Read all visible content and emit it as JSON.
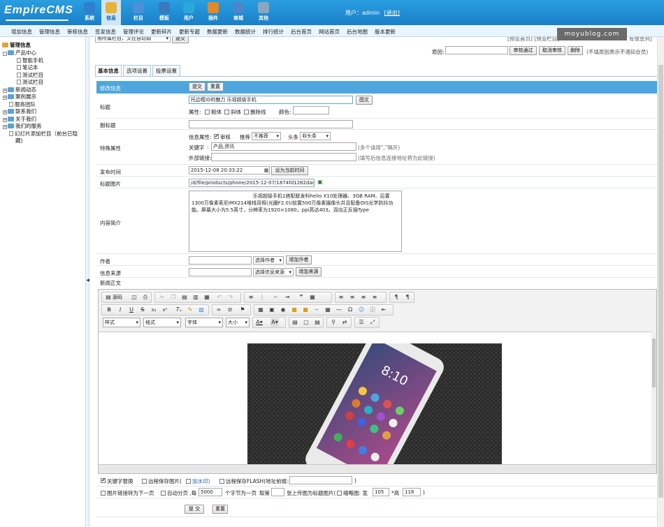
{
  "header": {
    "logo": "EmpireCMS",
    "nav": [
      {
        "label": "系统",
        "icon": "globe-icon",
        "color": "#2f7fd0"
      },
      {
        "label": "信息",
        "icon": "pencil-icon",
        "color": "#e7b33a"
      },
      {
        "label": "栏目",
        "icon": "folder-icon",
        "color": "#4b90d8"
      },
      {
        "label": "模板",
        "icon": "template-icon",
        "color": "#3a78c0"
      },
      {
        "label": "用户",
        "icon": "user-icon",
        "color": "#2aa9d8"
      },
      {
        "label": "插件",
        "icon": "puzzle-icon",
        "color": "#e28a2a"
      },
      {
        "label": "商城",
        "icon": "shop-icon",
        "color": "#4a86c8"
      },
      {
        "label": "其他",
        "icon": "gear-icon",
        "color": "#8aa6c0"
      }
    ],
    "user_prefix": "用户：",
    "username": "admin",
    "logout": "[退出]"
  },
  "menu": [
    "增加信息",
    "管理信息",
    "审核信息",
    "签发信息",
    "管理评论",
    "更新碎片",
    "更新专题",
    "数据更新",
    "数据统计",
    "排行统计",
    "后台首页",
    "网站首页",
    "后台地图",
    "版本更新"
  ],
  "sidebar": {
    "title": "管理信息",
    "tree": [
      {
        "label": "产品中心",
        "type": "folder",
        "level": 0,
        "prefix": "-"
      },
      {
        "label": "智能手机",
        "type": "page",
        "level": 2
      },
      {
        "label": "笔记本",
        "type": "page",
        "level": 2
      },
      {
        "label": "测试栏目",
        "type": "page",
        "level": 2
      },
      {
        "label": "测试栏目",
        "type": "page",
        "level": 2
      },
      {
        "label": "新闻动态",
        "type": "folder",
        "level": 0,
        "prefix": "+"
      },
      {
        "label": "案例展示",
        "type": "folder",
        "level": 0,
        "prefix": "+"
      },
      {
        "label": "服务团队",
        "type": "page",
        "level": 1
      },
      {
        "label": "联系我们",
        "type": "folder",
        "level": 0,
        "prefix": "+"
      },
      {
        "label": "关于我们",
        "type": "folder",
        "level": 0,
        "prefix": "+"
      },
      {
        "label": "我们的服务",
        "type": "folder",
        "level": 0,
        "prefix": "+"
      },
      {
        "label": "幻灯片添加栏目（前台已隐",
        "type": "page",
        "level": 1
      },
      {
        "label": "藏)",
        "type": "text",
        "level": 1
      }
    ]
  },
  "watermark": "moyublog.com",
  "top_area": {
    "partial_select": "用所属栏目，又在自动调",
    "partial_button": "提交",
    "partial_links": "[预览首页] [预览栏目]",
    "partial_right": "有信息列]",
    "reason_label": "原因:",
    "buttons": [
      "审核通过",
      "取消审核",
      "删除"
    ],
    "note": "(不填原因表示不通知会员)"
  },
  "tabs": [
    "基本信息",
    "选项设置",
    "投票设置"
  ],
  "form": {
    "section_label": "修改信息",
    "submit": "提交",
    "reset": "重置",
    "title_label": "标题",
    "title_value": "托边框ID的魅力 乐视超级手机",
    "title_image_btn": "图文",
    "attr_label": "属性:",
    "attrs": [
      "粗体",
      "斜体",
      "删除线"
    ],
    "color_label": "颜色:",
    "subtitle_label": "副标题",
    "special_label": "特殊属性",
    "info_attr_label": "信息属性:",
    "review_label": "审核",
    "recommend_label": "推荐",
    "recommend_value": "不推荐",
    "headline_label": "头条",
    "headline_value": "非头条",
    "keywords_label": "关键字",
    "keywords_value": "产品,资讯",
    "keywords_hint": "(多个请用\",\"隔开)",
    "external_label": "外部链接:",
    "external_hint": "(填写后信息连接地址将为此链接)",
    "publish_label": "发布时间",
    "publish_value": "2015-12-08 20:33:22",
    "set_now_btn": "设为当前时间",
    "titlepic_label": "标题图片",
    "titlepic_value": "/d/file/products/phone/2015-12-07/1874fd1282dad260",
    "intro_label": "内容简介",
    "intro_value": "乐视超级手机1搭配联发科helio X10处理器、3GB RAM、后置1300万像素索尼IMX214堆栈背照(光圈F2.0)/前置500万像素摄像头并且配备OIS光学防抖功能。屏幕大小为5.5英寸，分辨率为1920×1080，ppi高达403。双向正反插Type",
    "author_label": "作者",
    "author_select": "选择作者",
    "add_author": "增加作者",
    "source_label": "信息来源",
    "source_select": "选择信息来源",
    "add_source": "增加来源",
    "body_label": "新闻正文"
  },
  "editor": {
    "source_btn": "源码",
    "dropdowns": [
      "样式",
      "格式",
      "字体",
      "大小"
    ],
    "phone_time": "8:10"
  },
  "options": {
    "replace_keywords": "关键字替换",
    "remote_image": "远程保存图片(",
    "watermark": "加水印)",
    "remote_flash": "远程保存FLASH(地址前缀：",
    "flash_close": ")",
    "image_link": "图片链接转为下一页",
    "auto_page": "自动分页 ,每",
    "page_chars": "5000",
    "chars_suffix": "个字节为一页",
    "take_label": "取第",
    "take_suffix": "张上传图为标题图片(",
    "thumb_label": "缩略图: 宽",
    "thumb_w": "105",
    "thumb_h_label": "*高",
    "thumb_h": "118",
    "thumb_close": ")"
  },
  "footer": {
    "submit": "提 交",
    "reset": "重置"
  }
}
